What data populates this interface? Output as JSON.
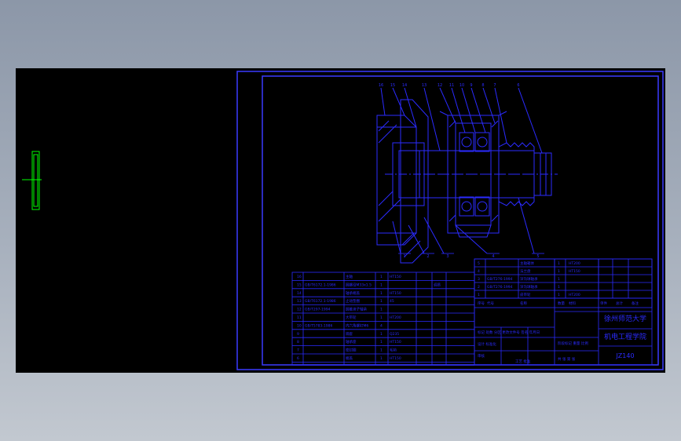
{
  "title_block": {
    "company_line1": "徐州师范大学",
    "company_line2": "机电工程学院",
    "drawing_number": "JZ140",
    "sign_row": "标记 处数 分区 更改文件号 签名 年月日",
    "design_row": "设计 标准化",
    "audit_row": "审核",
    "process_row": "工艺 批准",
    "scale_label": "阶段标记 重量 比例",
    "sheet_label": "共 张 第 张"
  },
  "parts_list": {
    "headers": [
      "序号",
      "代号",
      "名称",
      "数量",
      "材料",
      "单件",
      "总计",
      "备注"
    ],
    "left_rows": [
      {
        "no": "16",
        "code": "",
        "name": "主轴",
        "qty": "1",
        "material": "HT150",
        "note": ""
      },
      {
        "no": "15",
        "code": "GB/T6172.1-1986",
        "name": "圆螺母M33x1.5",
        "qty": "1",
        "material": "",
        "note": "调质"
      },
      {
        "no": "14",
        "code": "",
        "name": "轴承端盖",
        "qty": "1",
        "material": "HT150",
        "note": ""
      },
      {
        "no": "13",
        "code": "GB/T6172.1-1986",
        "name": "止动垫圈",
        "qty": "1",
        "material": "45",
        "note": ""
      },
      {
        "no": "12",
        "code": "GB/T297-1994",
        "name": "圆锥滚子轴承",
        "qty": "1",
        "material": "",
        "note": ""
      },
      {
        "no": "11",
        "code": "",
        "name": "大带轮",
        "qty": "1",
        "material": "HT200",
        "note": ""
      },
      {
        "no": "10",
        "code": "GB/T5783-1986",
        "name": "内六角螺钉M6",
        "qty": "4",
        "material": "",
        "note": ""
      },
      {
        "no": "9",
        "code": "",
        "name": "隔套",
        "qty": "1",
        "material": "Q235",
        "note": ""
      },
      {
        "no": "8",
        "code": "",
        "name": "轴承座",
        "qty": "1",
        "material": "HT150",
        "note": ""
      },
      {
        "no": "7",
        "code": "",
        "name": "密封圈",
        "qty": "1",
        "material": "毛毡",
        "note": ""
      },
      {
        "no": "6",
        "code": "",
        "name": "端盖",
        "qty": "1",
        "material": "HT150",
        "note": ""
      }
    ],
    "right_rows": [
      {
        "no": "5",
        "code": "",
        "name": "主轴箱体",
        "qty": "1",
        "material": "HT200"
      },
      {
        "no": "4",
        "code": "",
        "name": "法兰盘",
        "qty": "1",
        "material": "HT150"
      },
      {
        "no": "3",
        "code": "GB/T276-1994",
        "name": "深沟球轴承",
        "qty": "1",
        "material": ""
      },
      {
        "no": "2",
        "code": "GB/T276-1994",
        "name": "深沟球轴承",
        "qty": "1",
        "material": ""
      },
      {
        "no": "1",
        "code": "",
        "name": "皮带轮",
        "qty": "1",
        "material": "HT200"
      }
    ]
  },
  "balloons": {
    "top": [
      "16",
      "15",
      "14",
      "13",
      "12",
      "11",
      "10",
      "9",
      "8",
      "7",
      "6"
    ],
    "bottom": [
      "1",
      "2",
      "3",
      "4",
      "5"
    ]
  },
  "colors": {
    "background": "#000000",
    "lines": "#2b2bff",
    "border": "#3a3aff",
    "selection": "#00ff00"
  }
}
